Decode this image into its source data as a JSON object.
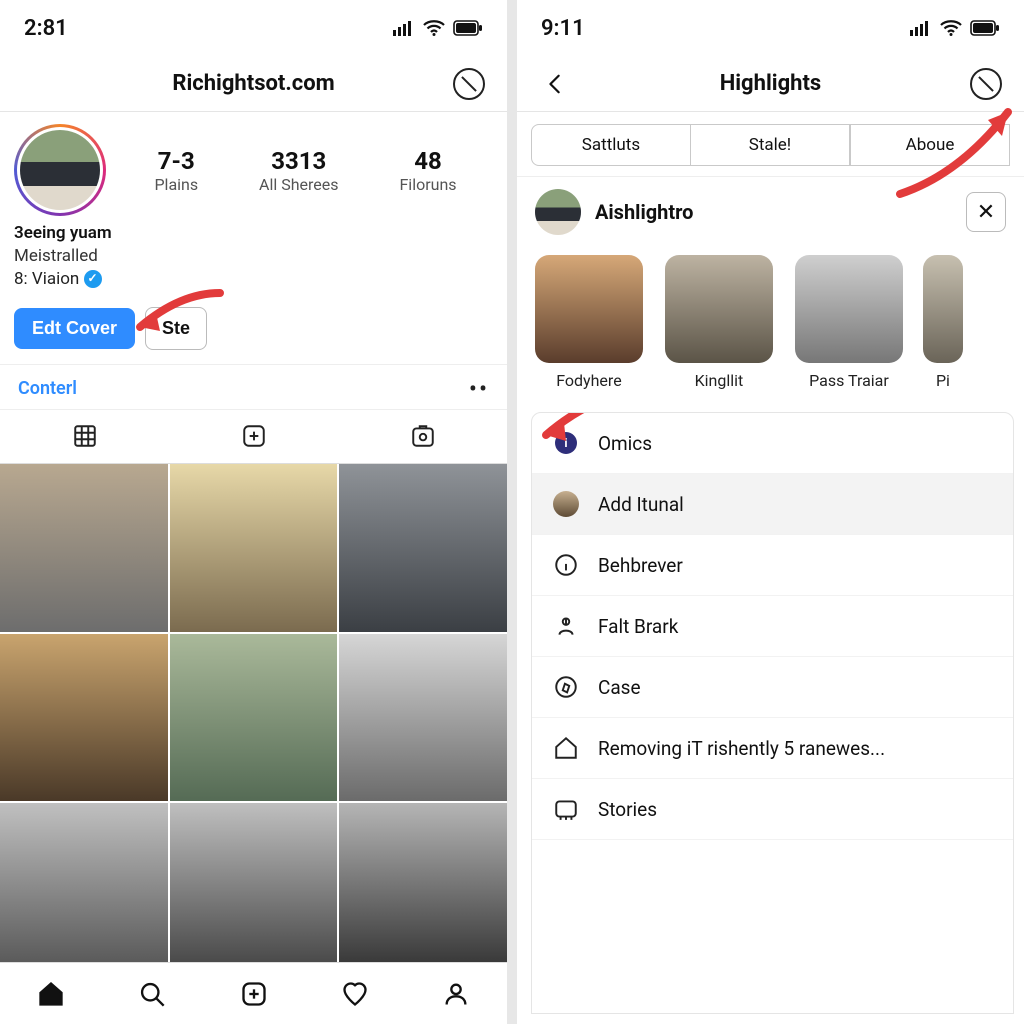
{
  "left": {
    "status": {
      "time": "2:81"
    },
    "nav": {
      "title": "Richightsot.com"
    },
    "stats": [
      {
        "num": "7-3",
        "label": "Plains"
      },
      {
        "num": "3313",
        "label": "All Sherees"
      },
      {
        "num": "48",
        "label": "Filoruns"
      }
    ],
    "bio": {
      "name": "3eeing yuam",
      "line2": "Meistralled",
      "line3": "8: Viaion"
    },
    "buttons": {
      "primary": "Edt Cover",
      "secondary": "Ste"
    },
    "content_tab": "Conterl"
  },
  "right": {
    "status": {
      "time": "9:11"
    },
    "nav": {
      "title": "Highlights"
    },
    "segments": [
      "Sattluts",
      "Stale!",
      "Aboue"
    ],
    "user": {
      "name": "Aishlightro"
    },
    "highlights": [
      {
        "label": "Fodyhere"
      },
      {
        "label": "Kingllit"
      },
      {
        "label": "Pass Traiar"
      },
      {
        "label": "Pi"
      }
    ],
    "menu": [
      {
        "label": "Omics"
      },
      {
        "label": "Add Itunal"
      },
      {
        "label": "Behbrever"
      },
      {
        "label": "Falt Brark"
      },
      {
        "label": "Case"
      },
      {
        "label": "Removing iT rishently 5 ranewes..."
      },
      {
        "label": "Stories"
      }
    ]
  }
}
